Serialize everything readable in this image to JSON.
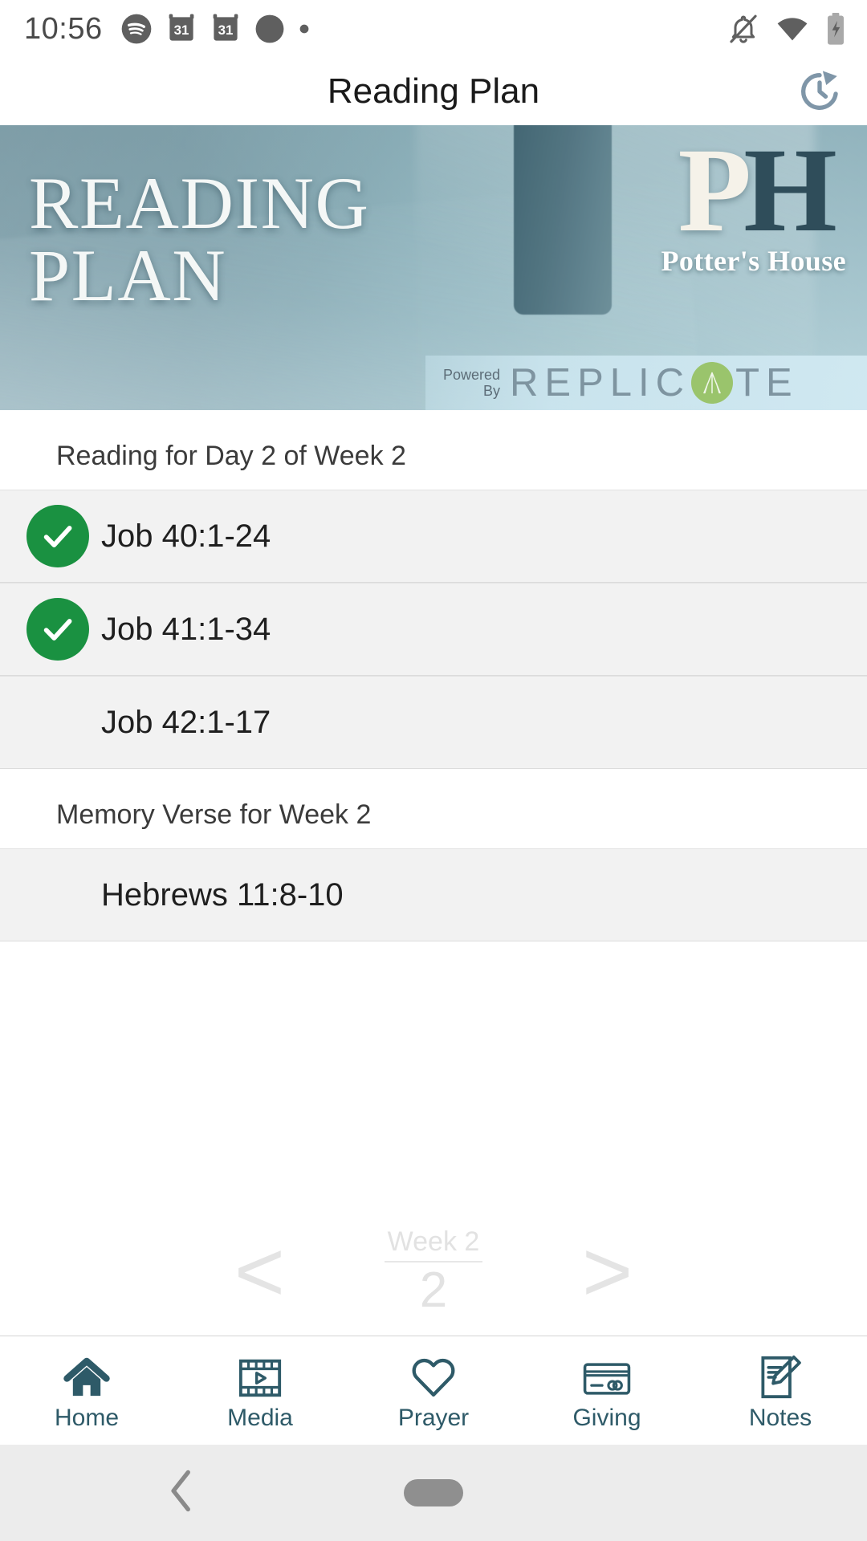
{
  "status_bar": {
    "time": "10:56",
    "left_icons": [
      "spotify-icon",
      "calendar-icon",
      "calendar-icon",
      "circle-notification-icon",
      "dot-notification-icon"
    ],
    "right_icons": [
      "notifications-silenced-icon",
      "wifi-icon",
      "battery-charging-icon"
    ]
  },
  "app_bar": {
    "title": "Reading Plan",
    "action_icon": "history-restore-icon"
  },
  "banner": {
    "title_line1": "READING",
    "title_line2": "PLAN",
    "logo_mark_p": "P",
    "logo_mark_h": "H",
    "church_name": "Potter's House",
    "powered_line1": "Powered",
    "powered_line2": "By",
    "replicate_pre": "REPLIC",
    "replicate_post": "TE",
    "replicate_accent_color": "#9ac46c"
  },
  "reading": {
    "section_label": "Reading for Day 2 of Week 2",
    "items": [
      {
        "reference": "Job 40:1-24",
        "completed": true
      },
      {
        "reference": "Job 41:1-34",
        "completed": true
      },
      {
        "reference": "Job 42:1-17",
        "completed": false
      }
    ],
    "check_color": "#1a9141"
  },
  "memory_verse": {
    "section_label": "Memory Verse for Week 2",
    "reference": "Hebrews 11:8-10"
  },
  "week_nav": {
    "prev_label": "<",
    "next_label": ">",
    "week_label": "Week 2",
    "week_number": "2"
  },
  "tab_bar": {
    "accent_color": "#2e5a68",
    "tabs": [
      {
        "label": "Home",
        "icon": "home-icon",
        "active": true
      },
      {
        "label": "Media",
        "icon": "film-icon",
        "active": false
      },
      {
        "label": "Prayer",
        "icon": "heart-icon",
        "active": false
      },
      {
        "label": "Giving",
        "icon": "credit-card-icon",
        "active": false
      },
      {
        "label": "Notes",
        "icon": "note-pencil-icon",
        "active": false
      }
    ]
  },
  "android_nav": {
    "back": "back-chevron-icon",
    "home": "home-pill-icon"
  }
}
